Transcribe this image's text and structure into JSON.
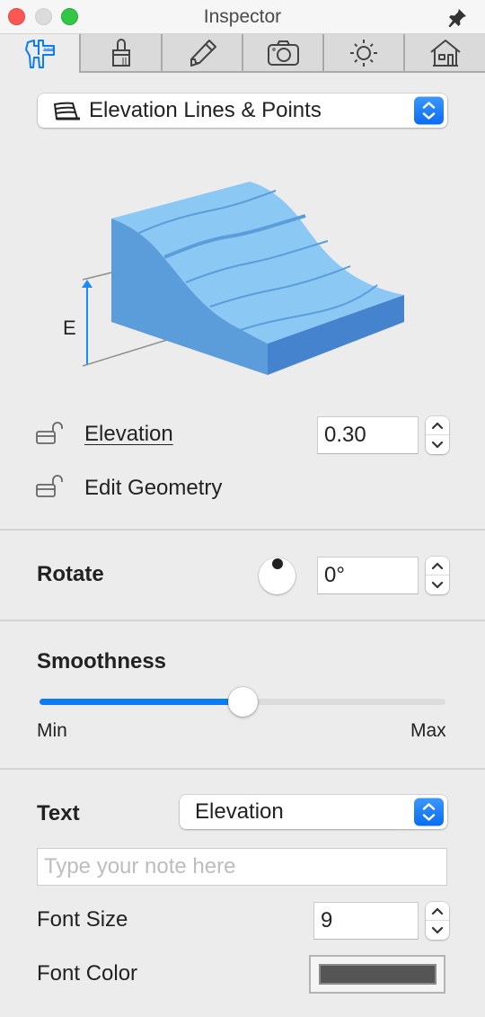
{
  "window": {
    "title": "Inspector",
    "controls": [
      "close",
      "minimize",
      "zoom"
    ],
    "pin_icon": "pin-icon"
  },
  "tabs": [
    {
      "icon": "caliper-icon",
      "label": "Measurements",
      "active": true
    },
    {
      "icon": "brush-icon",
      "label": "Style",
      "active": false
    },
    {
      "icon": "pencil-icon",
      "label": "Edit",
      "active": false
    },
    {
      "icon": "camera-icon",
      "label": "Camera",
      "active": false
    },
    {
      "icon": "sun-icon",
      "label": "Lighting",
      "active": false
    },
    {
      "icon": "house-icon",
      "label": "Building",
      "active": false
    }
  ],
  "mode_popup": {
    "icon": "elevation-lines-icon",
    "value": "Elevation Lines & Points"
  },
  "diagram": {
    "label": "E",
    "colors": {
      "top": "#8cc8f4",
      "front": "#5b9dda",
      "side": "#4583cf",
      "contour": "#5b9dda",
      "arrow": "#1a8cf7",
      "guide": "#8f8f8f"
    }
  },
  "elevation": {
    "label": "Elevation",
    "mnemonic": "E",
    "value": "0.30",
    "locked": false
  },
  "edit_geometry": {
    "label": "Edit Geometry",
    "locked": false
  },
  "rotate": {
    "label": "Rotate",
    "value": "0°",
    "angle_degrees": 0
  },
  "smoothness": {
    "label": "Smoothness",
    "min_label": "Min",
    "max_label": "Max",
    "value_fraction": 0.5
  },
  "text": {
    "label": "Text",
    "selected": "Elevation",
    "note_placeholder": "Type your note here",
    "note_value": ""
  },
  "font_size": {
    "label": "Font Size",
    "value": "9"
  },
  "font_color": {
    "label": "Font Color",
    "value": "#555555"
  },
  "colors": {
    "accent": "#0a7cf6",
    "background": "#ececec"
  }
}
